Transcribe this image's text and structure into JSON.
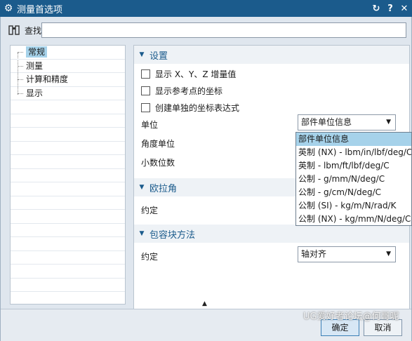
{
  "window": {
    "title": "测量首选项"
  },
  "find": {
    "label": "查找",
    "value": ""
  },
  "tree": {
    "items": [
      "常规",
      "测量",
      "计算和精度",
      "显示"
    ],
    "selected": "常规"
  },
  "settings": {
    "title": "设置",
    "checkboxes": [
      "显示 X、Y、Z 增量值",
      "显示参考点的坐标",
      "创建单独的坐标表达式"
    ],
    "unit_label": "单位",
    "unit_value": "部件单位信息",
    "angle_label": "角度单位",
    "decimal_label": "小数位数"
  },
  "unit_options": [
    "部件单位信息",
    "英制 (NX) - lbm/in/lbf/deg/C",
    "英制 - lbm/ft/lbf/deg/C",
    "公制 - g/mm/N/deg/C",
    "公制 - g/cm/N/deg/C",
    "公制 (SI) - kg/m/N/rad/K",
    "公制 (NX) - kg/mm/N/deg/C"
  ],
  "euler": {
    "title": "欧拉角",
    "convention_label": "约定"
  },
  "bbox": {
    "title": "包容块方法",
    "convention_label": "约定",
    "convention_value": "轴对齐"
  },
  "buttons": {
    "ok": "确定",
    "cancel": "取消"
  },
  "watermark": "UG爱好者论坛@何哥呢"
}
